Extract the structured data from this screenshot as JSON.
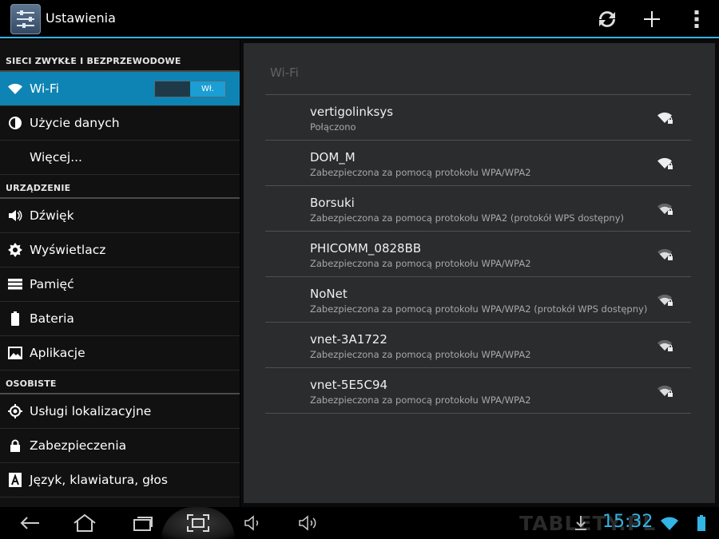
{
  "app": {
    "title": "Ustawienia",
    "icon": "settings-sliders-icon"
  },
  "actionbar": {
    "actions": [
      "sync-icon",
      "add-icon",
      "overflow-menu-icon"
    ]
  },
  "sidebar": {
    "sections": [
      {
        "title": "SIECI ZWYKŁE I BEZPRZEWODOWE",
        "items": [
          {
            "label": "Wi-Fi",
            "icon": "wifi-icon",
            "selected": true,
            "toggle": "Wł."
          },
          {
            "label": "Użycie danych",
            "icon": "data-usage-icon"
          },
          {
            "label": "Więcej...",
            "icon": ""
          }
        ]
      },
      {
        "title": "URZĄDZENIE",
        "items": [
          {
            "label": "Dźwięk",
            "icon": "speaker-icon"
          },
          {
            "label": "Wyświetlacz",
            "icon": "brightness-icon"
          },
          {
            "label": "Pamięć",
            "icon": "storage-icon"
          },
          {
            "label": "Bateria",
            "icon": "battery-icon"
          },
          {
            "label": "Aplikacje",
            "icon": "apps-icon"
          }
        ]
      },
      {
        "title": "OSOBISTE",
        "items": [
          {
            "label": "Usługi lokalizacyjne",
            "icon": "location-icon"
          },
          {
            "label": "Zabezpieczenia",
            "icon": "lock-icon"
          },
          {
            "label": "Język, klawiatura, głos",
            "icon": "language-icon"
          }
        ]
      }
    ]
  },
  "main": {
    "title": "Wi-Fi",
    "networks": [
      {
        "ssid": "vertigolinksys",
        "status": "Połączono"
      },
      {
        "ssid": "DOM_M",
        "status": "Zabezpieczona za pomocą protokołu WPA/WPA2"
      },
      {
        "ssid": "Borsuki",
        "status": "Zabezpieczona za pomocą protokołu WPA2 (protokół WPS dostępny)"
      },
      {
        "ssid": "PHICOMM_0828BB",
        "status": "Zabezpieczona za pomocą protokołu WPA/WPA2"
      },
      {
        "ssid": "NoNet",
        "status": "Zabezpieczona za pomocą protokołu WPA/WPA2 (protokół WPS dostępny)"
      },
      {
        "ssid": "vnet-3A1722",
        "status": "Zabezpieczona za pomocą protokołu WPA/WPA2"
      },
      {
        "ssid": "vnet-5E5C94",
        "status": "Zabezpieczona za pomocą protokołu WPA/WPA2"
      }
    ]
  },
  "navbar": {
    "buttons": [
      "back-icon",
      "home-icon",
      "recent-apps-icon",
      "screenshot-icon",
      "volume-down-icon",
      "volume-up-icon"
    ],
    "watermark": "TABLETY.PL",
    "time": "15:32"
  },
  "colors": {
    "accent": "#33b5e5",
    "selected": "#0e84b4"
  }
}
